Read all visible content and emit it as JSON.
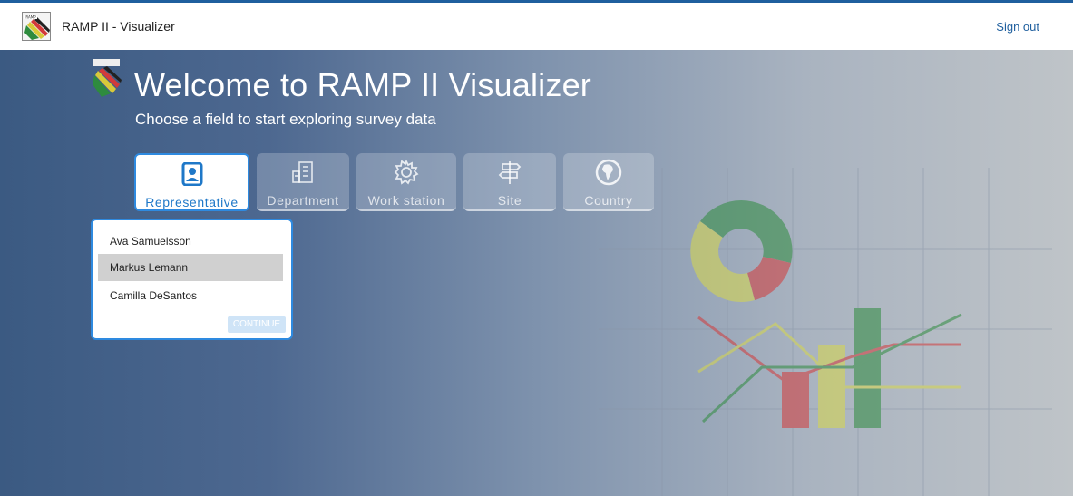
{
  "header": {
    "logo_text": "RAMP",
    "app_title": "RAMP II - Visualizer",
    "signout_label": "Sign out"
  },
  "hero": {
    "welcome": "Welcome to RAMP II Visualizer",
    "subtitle": "Choose a field to start exploring survey data"
  },
  "fields": [
    {
      "label": "Representative",
      "icon": "person-badge-icon",
      "active": true
    },
    {
      "label": "Department",
      "icon": "building-icon",
      "active": false
    },
    {
      "label": "Work station",
      "icon": "gear-icon",
      "active": false
    },
    {
      "label": "Site",
      "icon": "signpost-icon",
      "active": false
    },
    {
      "label": "Country",
      "icon": "globe-icon",
      "active": false
    }
  ],
  "dropdown": {
    "options": [
      "Ava Samuelsson",
      "Markus Lemann",
      "Camilla DeSantos"
    ],
    "selected": "Markus Lemann",
    "continue_label": "CONTINUE"
  },
  "colors": {
    "accent": "#2e8ae0",
    "top_border": "#1f5f9e",
    "green": "#2e8b3e",
    "yellow": "#d8d84a",
    "red": "#d33a3a"
  }
}
